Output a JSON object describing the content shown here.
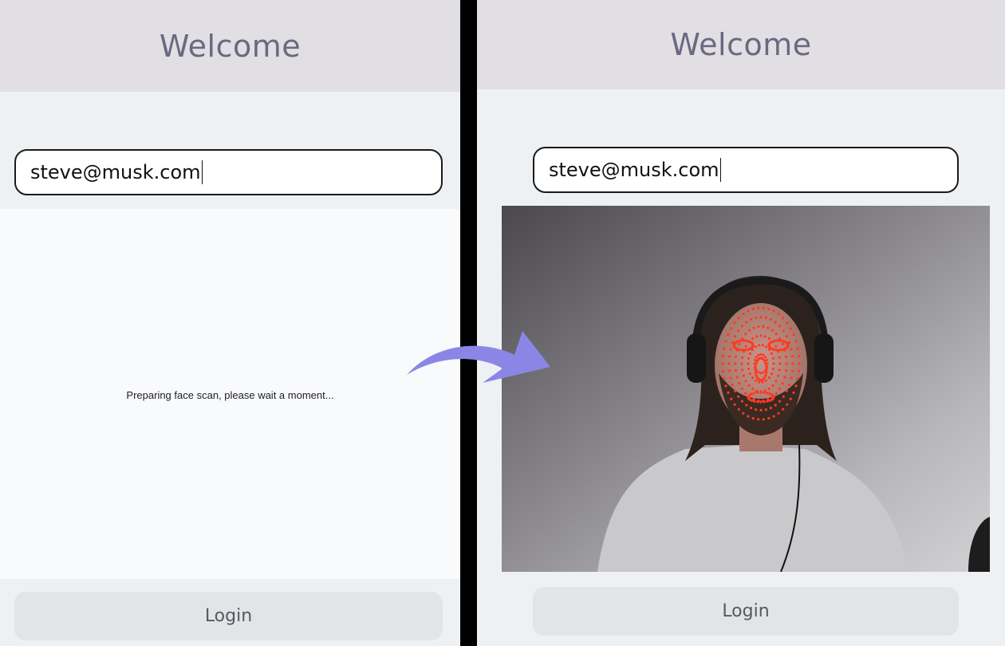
{
  "left_screen": {
    "header": {
      "title": "Welcome"
    },
    "email_field": {
      "value": "steve@musk.com"
    },
    "status_text": "Preparing face scan, please wait a moment...",
    "login_label": "Login"
  },
  "right_screen": {
    "header": {
      "title": "Welcome"
    },
    "email_field": {
      "value": "steve@musk.com"
    },
    "camera_feed": {
      "overlay": "face-landmark-mesh",
      "overlay_color": "#ff3a22"
    },
    "login_label": "Login"
  },
  "transition": {
    "icon": "curved-arrow-right-icon",
    "color": "#8b86e6"
  },
  "colors": {
    "header_bg": "#e1dfe4",
    "title_text": "#6b6880",
    "page_bg": "#eef1f4",
    "button_bg": "#e2e5e7",
    "divider": "#000000"
  }
}
